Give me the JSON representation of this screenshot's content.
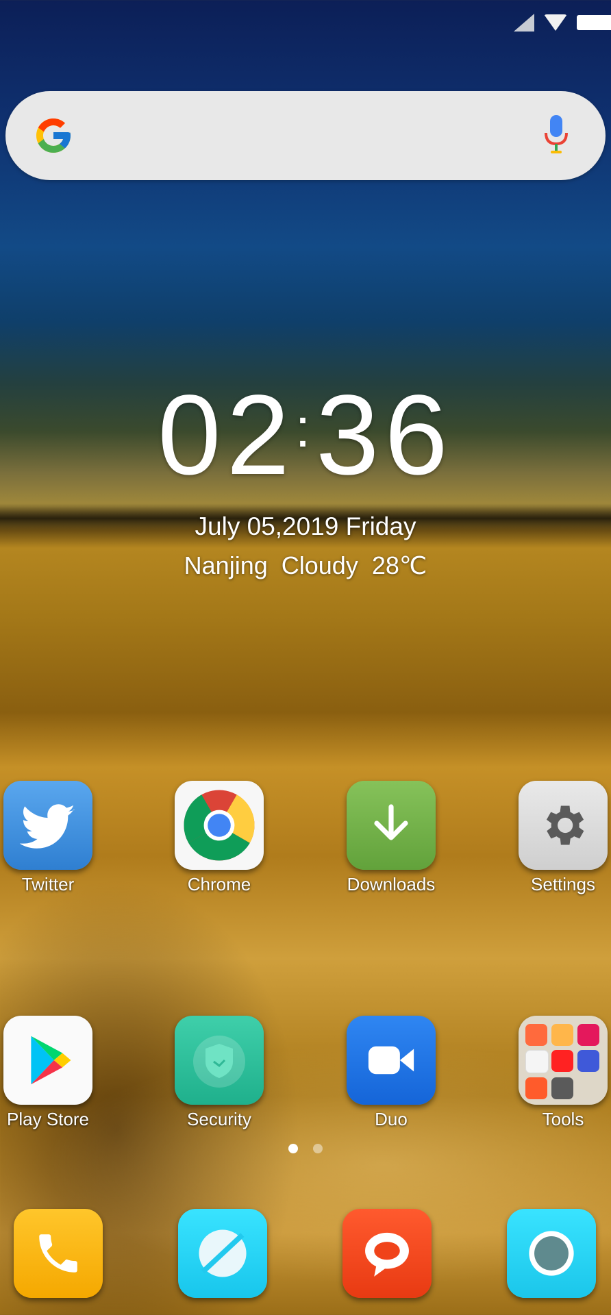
{
  "status_bar": {
    "icons": [
      "cellular-signal-icon",
      "wifi-icon",
      "battery-icon"
    ]
  },
  "search_widget": {
    "logo": "google-logo-icon",
    "voice_icon": "microphone-icon"
  },
  "clock_widget": {
    "hours": "02",
    "separator": ":",
    "minutes": "36",
    "date": "July 05,2019 Friday",
    "city": "Nanjing",
    "condition": "Cloudy",
    "temperature": "28℃"
  },
  "home_row_1": [
    {
      "label": "Twitter",
      "icon": "twitter-bird-icon"
    },
    {
      "label": "Chrome",
      "icon": "chrome-icon"
    },
    {
      "label": "Downloads",
      "icon": "download-arrow-icon"
    },
    {
      "label": "Settings",
      "icon": "gear-icon"
    }
  ],
  "home_row_2": [
    {
      "label": "Play Store",
      "icon": "play-store-icon"
    },
    {
      "label": "Security",
      "icon": "shield-icon"
    },
    {
      "label": "Duo",
      "icon": "video-camera-icon"
    },
    {
      "label": "Tools",
      "icon": "folder-icon"
    }
  ],
  "page_indicator": {
    "pages": 2,
    "current": 1
  },
  "dock": [
    {
      "icon": "phone-icon"
    },
    {
      "icon": "browser-icon"
    },
    {
      "icon": "messages-icon"
    },
    {
      "icon": "camera-icon"
    }
  ],
  "colors": {
    "twitter": "#4a97e2",
    "downloads": "#74b24b",
    "security": "#2fc09c",
    "duo": "#1f74e6",
    "phone": "#fbb717",
    "messages": "#f24a20",
    "browser": "#22d3f5"
  }
}
